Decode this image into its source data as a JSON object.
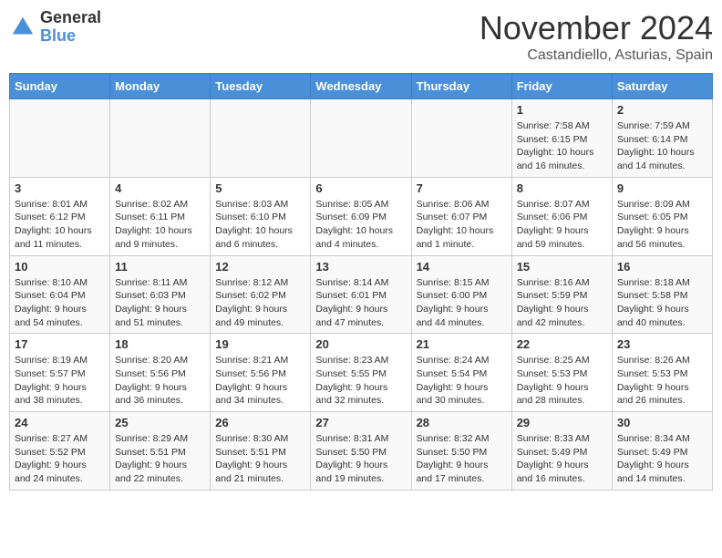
{
  "header": {
    "logo_general": "General",
    "logo_blue": "Blue",
    "month_title": "November 2024",
    "location": "Castandiello, Asturias, Spain"
  },
  "days_of_week": [
    "Sunday",
    "Monday",
    "Tuesday",
    "Wednesday",
    "Thursday",
    "Friday",
    "Saturday"
  ],
  "weeks": [
    [
      {
        "day": "",
        "info": ""
      },
      {
        "day": "",
        "info": ""
      },
      {
        "day": "",
        "info": ""
      },
      {
        "day": "",
        "info": ""
      },
      {
        "day": "",
        "info": ""
      },
      {
        "day": "1",
        "info": "Sunrise: 7:58 AM\nSunset: 6:15 PM\nDaylight: 10 hours and 16 minutes."
      },
      {
        "day": "2",
        "info": "Sunrise: 7:59 AM\nSunset: 6:14 PM\nDaylight: 10 hours and 14 minutes."
      }
    ],
    [
      {
        "day": "3",
        "info": "Sunrise: 8:01 AM\nSunset: 6:12 PM\nDaylight: 10 hours and 11 minutes."
      },
      {
        "day": "4",
        "info": "Sunrise: 8:02 AM\nSunset: 6:11 PM\nDaylight: 10 hours and 9 minutes."
      },
      {
        "day": "5",
        "info": "Sunrise: 8:03 AM\nSunset: 6:10 PM\nDaylight: 10 hours and 6 minutes."
      },
      {
        "day": "6",
        "info": "Sunrise: 8:05 AM\nSunset: 6:09 PM\nDaylight: 10 hours and 4 minutes."
      },
      {
        "day": "7",
        "info": "Sunrise: 8:06 AM\nSunset: 6:07 PM\nDaylight: 10 hours and 1 minute."
      },
      {
        "day": "8",
        "info": "Sunrise: 8:07 AM\nSunset: 6:06 PM\nDaylight: 9 hours and 59 minutes."
      },
      {
        "day": "9",
        "info": "Sunrise: 8:09 AM\nSunset: 6:05 PM\nDaylight: 9 hours and 56 minutes."
      }
    ],
    [
      {
        "day": "10",
        "info": "Sunrise: 8:10 AM\nSunset: 6:04 PM\nDaylight: 9 hours and 54 minutes."
      },
      {
        "day": "11",
        "info": "Sunrise: 8:11 AM\nSunset: 6:03 PM\nDaylight: 9 hours and 51 minutes."
      },
      {
        "day": "12",
        "info": "Sunrise: 8:12 AM\nSunset: 6:02 PM\nDaylight: 9 hours and 49 minutes."
      },
      {
        "day": "13",
        "info": "Sunrise: 8:14 AM\nSunset: 6:01 PM\nDaylight: 9 hours and 47 minutes."
      },
      {
        "day": "14",
        "info": "Sunrise: 8:15 AM\nSunset: 6:00 PM\nDaylight: 9 hours and 44 minutes."
      },
      {
        "day": "15",
        "info": "Sunrise: 8:16 AM\nSunset: 5:59 PM\nDaylight: 9 hours and 42 minutes."
      },
      {
        "day": "16",
        "info": "Sunrise: 8:18 AM\nSunset: 5:58 PM\nDaylight: 9 hours and 40 minutes."
      }
    ],
    [
      {
        "day": "17",
        "info": "Sunrise: 8:19 AM\nSunset: 5:57 PM\nDaylight: 9 hours and 38 minutes."
      },
      {
        "day": "18",
        "info": "Sunrise: 8:20 AM\nSunset: 5:56 PM\nDaylight: 9 hours and 36 minutes."
      },
      {
        "day": "19",
        "info": "Sunrise: 8:21 AM\nSunset: 5:56 PM\nDaylight: 9 hours and 34 minutes."
      },
      {
        "day": "20",
        "info": "Sunrise: 8:23 AM\nSunset: 5:55 PM\nDaylight: 9 hours and 32 minutes."
      },
      {
        "day": "21",
        "info": "Sunrise: 8:24 AM\nSunset: 5:54 PM\nDaylight: 9 hours and 30 minutes."
      },
      {
        "day": "22",
        "info": "Sunrise: 8:25 AM\nSunset: 5:53 PM\nDaylight: 9 hours and 28 minutes."
      },
      {
        "day": "23",
        "info": "Sunrise: 8:26 AM\nSunset: 5:53 PM\nDaylight: 9 hours and 26 minutes."
      }
    ],
    [
      {
        "day": "24",
        "info": "Sunrise: 8:27 AM\nSunset: 5:52 PM\nDaylight: 9 hours and 24 minutes."
      },
      {
        "day": "25",
        "info": "Sunrise: 8:29 AM\nSunset: 5:51 PM\nDaylight: 9 hours and 22 minutes."
      },
      {
        "day": "26",
        "info": "Sunrise: 8:30 AM\nSunset: 5:51 PM\nDaylight: 9 hours and 21 minutes."
      },
      {
        "day": "27",
        "info": "Sunrise: 8:31 AM\nSunset: 5:50 PM\nDaylight: 9 hours and 19 minutes."
      },
      {
        "day": "28",
        "info": "Sunrise: 8:32 AM\nSunset: 5:50 PM\nDaylight: 9 hours and 17 minutes."
      },
      {
        "day": "29",
        "info": "Sunrise: 8:33 AM\nSunset: 5:49 PM\nDaylight: 9 hours and 16 minutes."
      },
      {
        "day": "30",
        "info": "Sunrise: 8:34 AM\nSunset: 5:49 PM\nDaylight: 9 hours and 14 minutes."
      }
    ]
  ]
}
